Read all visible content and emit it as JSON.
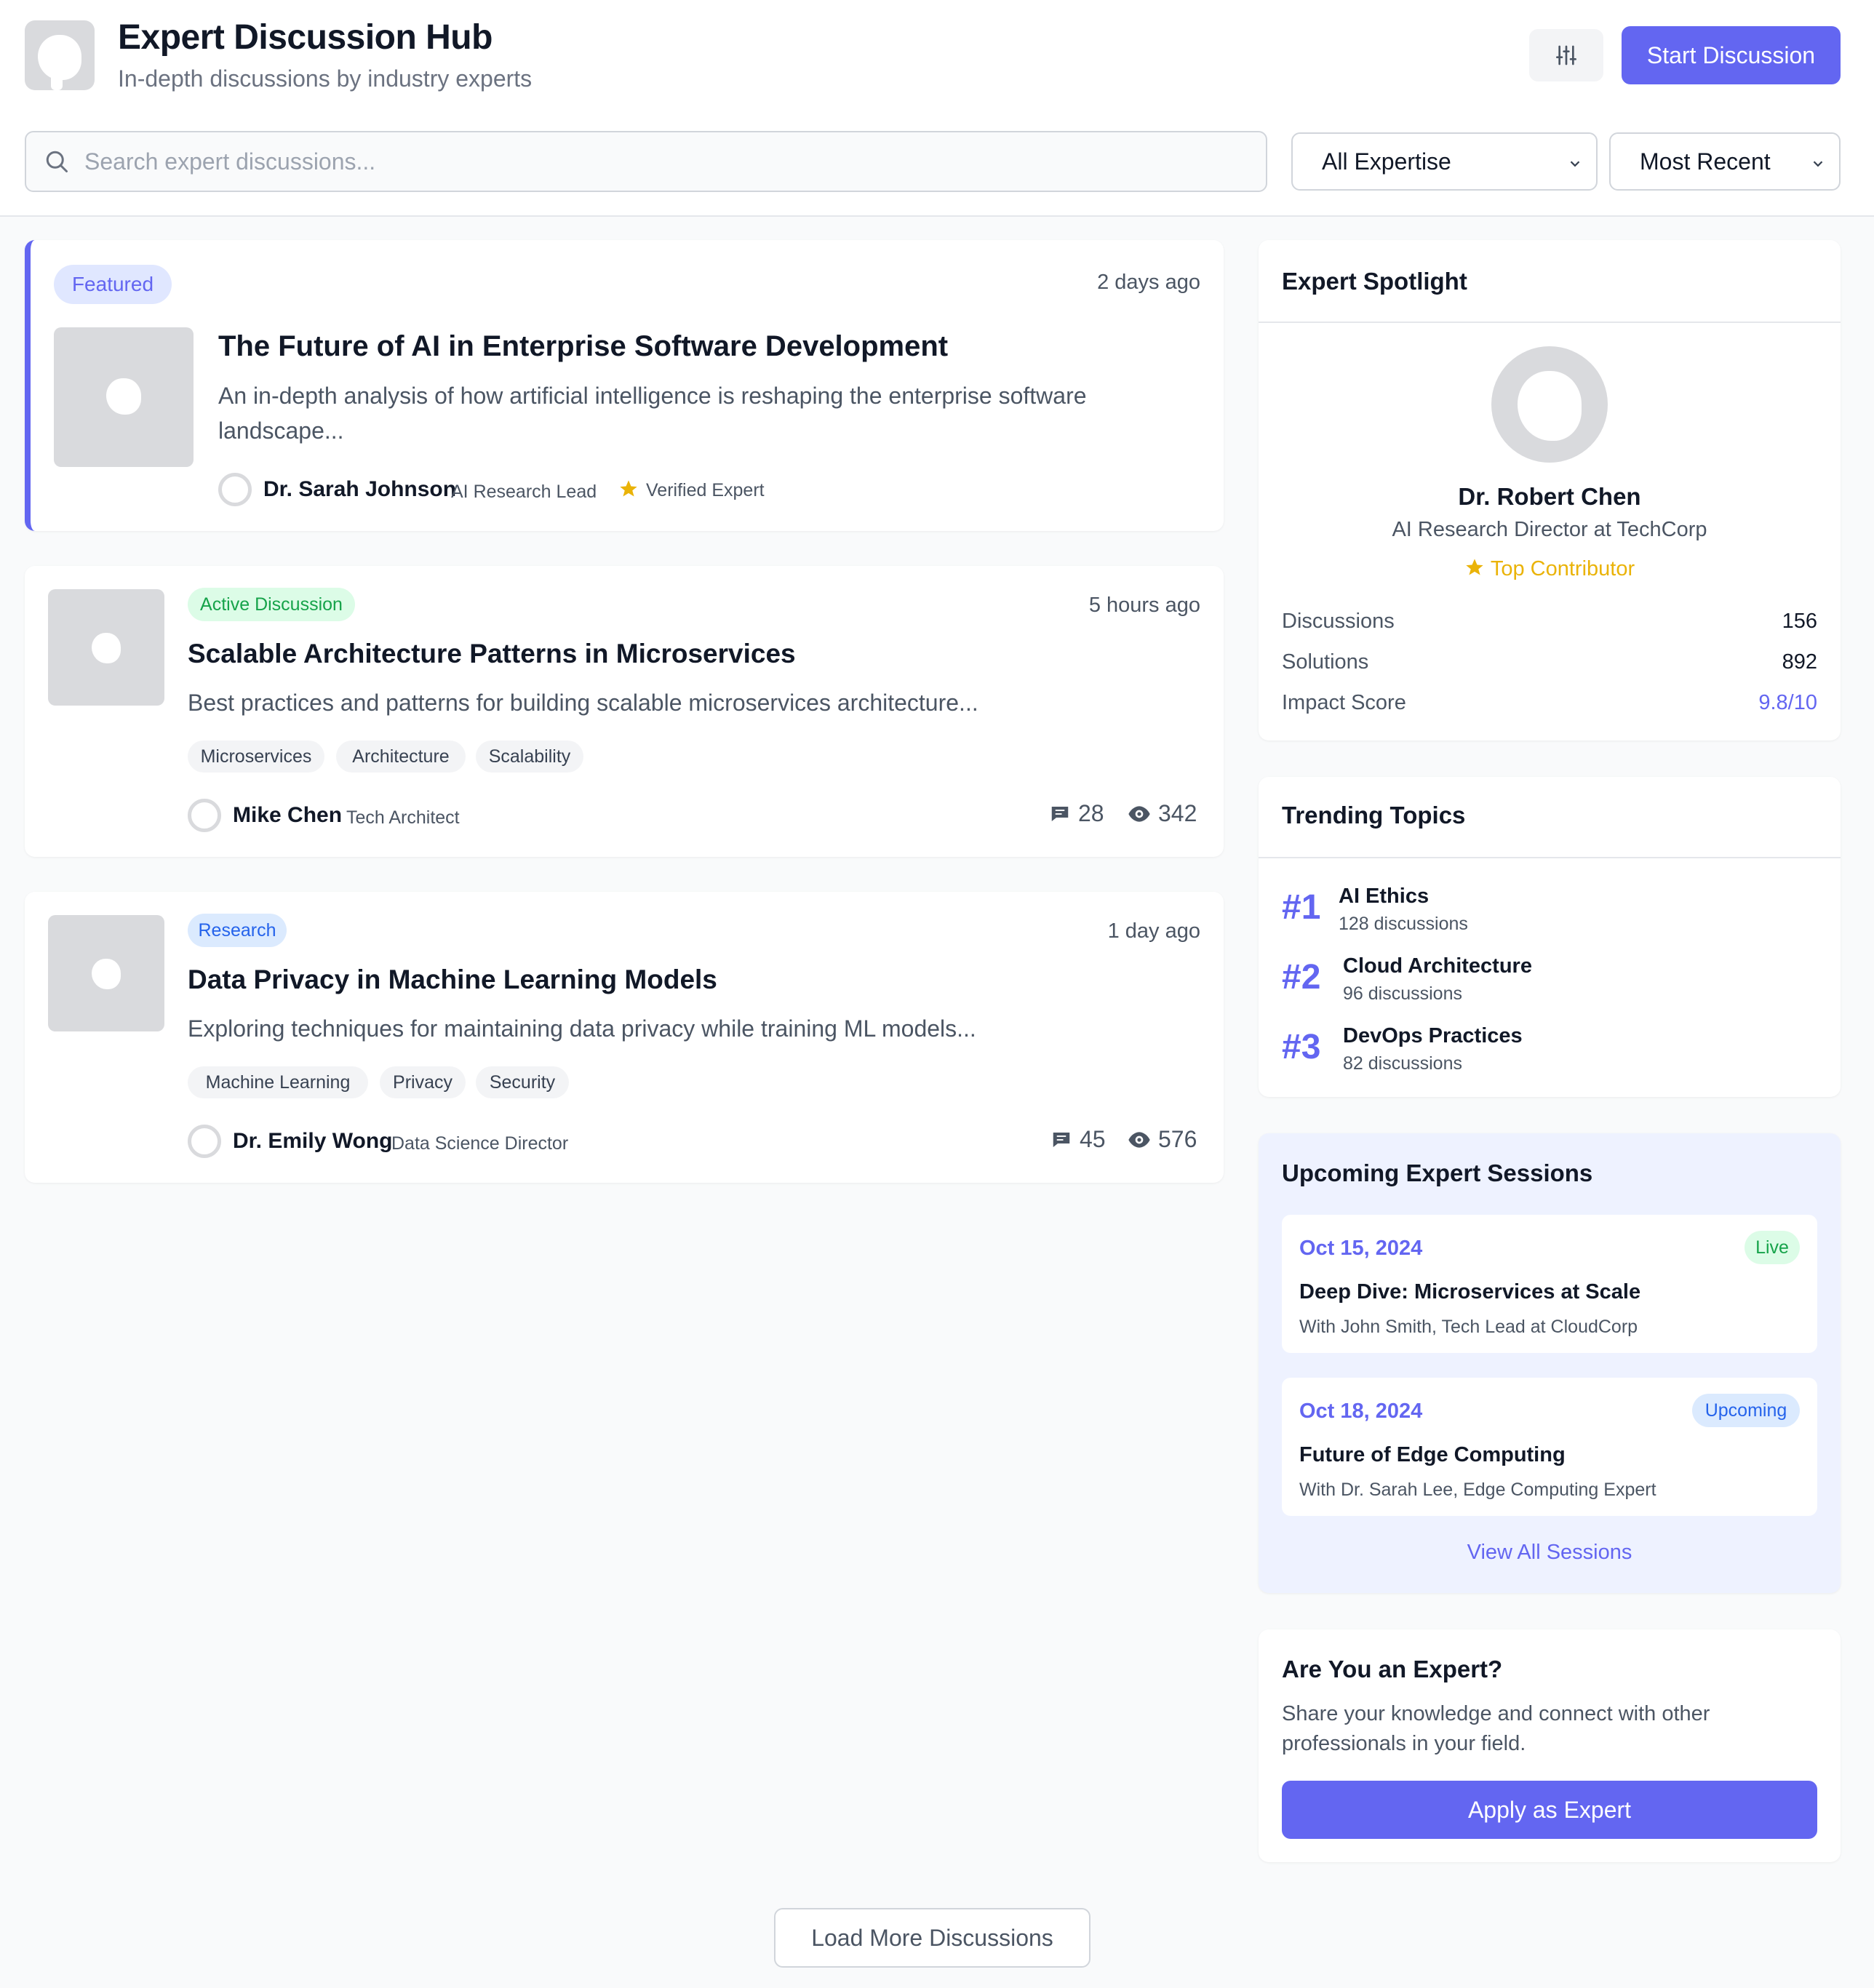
{
  "header": {
    "title": "Expert Discussion Hub",
    "subtitle": "In-depth discussions by industry experts",
    "start_button": "Start Discussion",
    "search_placeholder": "Search expert discussions...",
    "expertise_select": "All Expertise",
    "sort_select": "Most Recent"
  },
  "discussions": [
    {
      "badge": "Featured",
      "time": "2 days ago",
      "title": "The Future of AI in Enterprise Software Development",
      "description": "An in-depth analysis of how artificial intelligence is reshaping the enterprise software landscape...",
      "author": "Dr. Sarah Johnson",
      "role": "AI Research Lead",
      "verified": "Verified Expert"
    },
    {
      "badge": "Active Discussion",
      "time": "5 hours ago",
      "title": "Scalable Architecture Patterns in Microservices",
      "description": "Best practices and patterns for building scalable microservices architecture...",
      "tags": [
        "Microservices",
        "Architecture",
        "Scalability"
      ],
      "author": "Mike Chen",
      "role": "Tech Architect",
      "comments": "28",
      "views": "342"
    },
    {
      "badge": "Research",
      "time": "1 day ago",
      "title": "Data Privacy in Machine Learning Models",
      "description": "Exploring techniques for maintaining data privacy while training ML models...",
      "tags": [
        "Machine Learning",
        "Privacy",
        "Security"
      ],
      "author": "Dr. Emily Wong",
      "role": "Data Science Director",
      "comments": "45",
      "views": "576"
    }
  ],
  "spotlight": {
    "heading": "Expert Spotlight",
    "name": "Dr. Robert Chen",
    "title": "AI Research Director at TechCorp",
    "badge": "Top Contributor",
    "stats": [
      {
        "label": "Discussions",
        "value": "156"
      },
      {
        "label": "Solutions",
        "value": "892"
      },
      {
        "label": "Impact Score",
        "value": "9.8/10"
      }
    ]
  },
  "trending": {
    "heading": "Trending Topics",
    "topics": [
      {
        "rank": "#1",
        "name": "AI Ethics",
        "count": "128 discussions"
      },
      {
        "rank": "#2",
        "name": "Cloud Architecture",
        "count": "96 discussions"
      },
      {
        "rank": "#3",
        "name": "DevOps Practices",
        "count": "82 discussions"
      }
    ]
  },
  "sessions": {
    "heading": "Upcoming Expert Sessions",
    "items": [
      {
        "date": "Oct 15, 2024",
        "status": "Live",
        "title": "Deep Dive: Microservices at Scale",
        "with": "With John Smith, Tech Lead at CloudCorp"
      },
      {
        "date": "Oct 18, 2024",
        "status": "Upcoming",
        "title": "Future of Edge Computing",
        "with": "With Dr. Sarah Lee, Edge Computing Expert"
      }
    ],
    "view_all": "View All Sessions"
  },
  "expert_cta": {
    "heading": "Are You an Expert?",
    "text": "Share your knowledge and connect with other professionals in your field.",
    "button": "Apply as Expert"
  },
  "load_more": "Load More Discussions",
  "colors": {
    "accent": "#6366f1",
    "star": "#eab308",
    "green": "#16a34a",
    "blue": "#2563eb"
  }
}
